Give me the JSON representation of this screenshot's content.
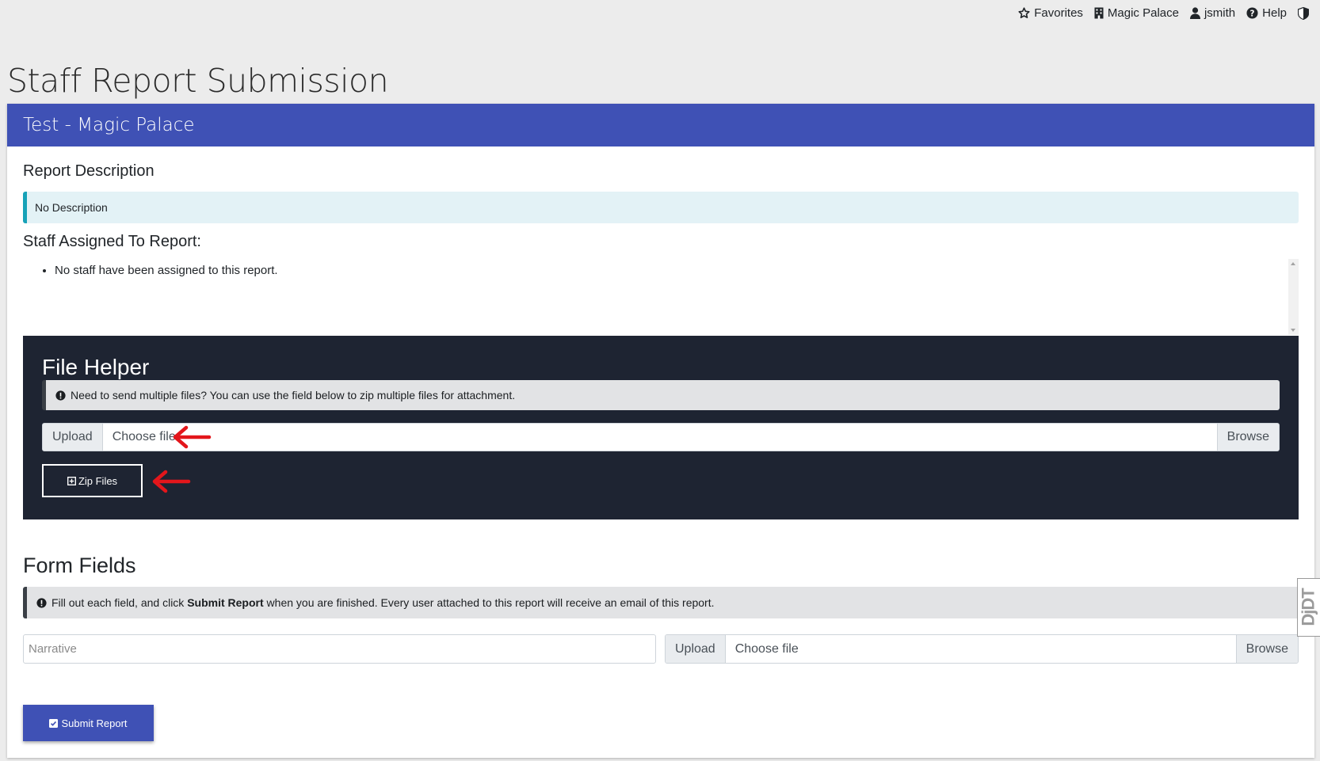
{
  "nav": {
    "favorites": "Favorites",
    "location": "Magic Palace",
    "user": "jsmith",
    "help": "Help"
  },
  "page": {
    "title": "Staff Report Submission"
  },
  "card": {
    "header": "Test - Magic Palace",
    "report_description_heading": "Report Description",
    "description": "No Description",
    "staff_heading": "Staff Assigned To Report:",
    "staff_items": [
      "No staff have been assigned to this report."
    ]
  },
  "file_helper": {
    "title": "File Helper",
    "alert": "Need to send multiple files? You can use the field below to zip multiple files for attachment.",
    "upload_label": "Upload",
    "choose_file": "Choose file",
    "browse_label": "Browse",
    "zip_button": "Zip Files"
  },
  "form": {
    "heading": "Form Fields",
    "alert_pre": "Fill out each field, and click ",
    "alert_bold": "Submit Report",
    "alert_post": " when you are finished. Every user attached to this report will receive an email of this report.",
    "narrative_placeholder": "Narrative",
    "upload_label": "Upload",
    "choose_file": "Choose file",
    "browse_label": "Browse",
    "submit_button": "Submit Report"
  },
  "debug_toolbar": {
    "label": "DjDT"
  },
  "colors": {
    "brand": "#3f51b5",
    "dark_panel": "#1e2432",
    "info_bg": "#e3f2f6",
    "info_border": "#17a2b8",
    "annotation_arrow": "#e3161b"
  }
}
